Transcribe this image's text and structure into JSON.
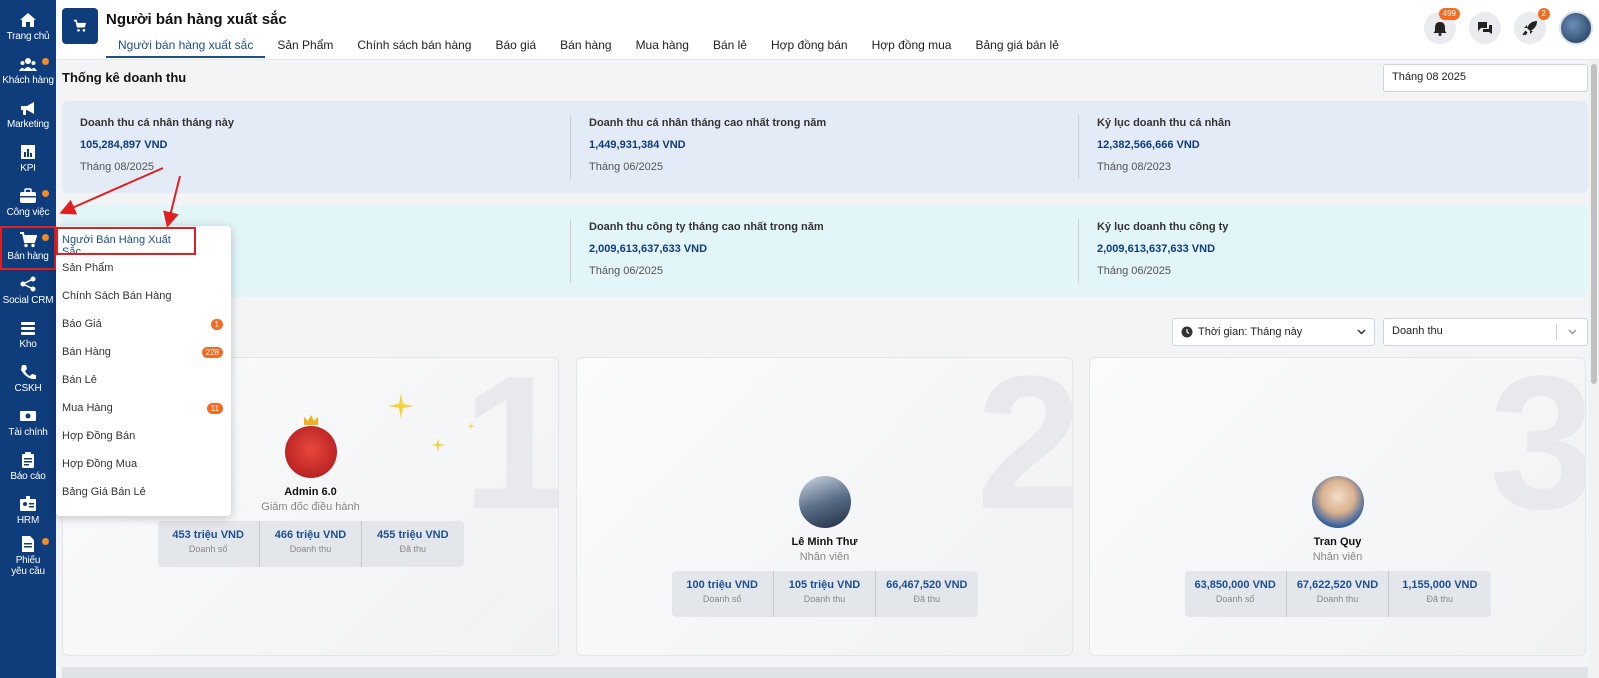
{
  "sidebar": {
    "items": [
      {
        "label": "Trang chủ",
        "icon": "home-icon"
      },
      {
        "label": "Khách hàng",
        "icon": "users-icon"
      },
      {
        "label": "Marketing",
        "icon": "megaphone-icon"
      },
      {
        "label": "KPI",
        "icon": "chart-icon"
      },
      {
        "label": "Công việc",
        "icon": "briefcase-icon"
      },
      {
        "label": "Bán hàng",
        "icon": "cart-icon"
      },
      {
        "label": "Social CRM",
        "icon": "share-icon"
      },
      {
        "label": "Kho",
        "icon": "warehouse-icon"
      },
      {
        "label": "CSKH",
        "icon": "phone-icon"
      },
      {
        "label": "Tài chính",
        "icon": "money-icon"
      },
      {
        "label": "Báo cáo",
        "icon": "clipboard-icon"
      },
      {
        "label": "HRM",
        "icon": "id-card-icon"
      },
      {
        "label": "Phiếu yêu cầu",
        "icon": "document-icon"
      }
    ]
  },
  "header": {
    "title": "Người bán hàng xuất sắc",
    "tabs": [
      "Người bán hàng xuất sắc",
      "Sản Phẩm",
      "Chính sách bán hàng",
      "Báo giá",
      "Bán hàng",
      "Mua hàng",
      "Bán lẻ",
      "Hợp đồng bán",
      "Hợp đồng mua",
      "Bảng giá bán lẻ"
    ],
    "notif_count": "499",
    "rocket_count": "2"
  },
  "main": {
    "section_title": "Thống kê doanh thu",
    "month": "Tháng 08 2025",
    "personal": [
      {
        "label": "Doanh thu cá nhân tháng này",
        "value": "105,284,897 VND",
        "date": "Tháng 08/2025"
      },
      {
        "label": "Doanh thu cá nhân tháng cao nhất trong năm",
        "value": "1,449,931,384 VND",
        "date": "Tháng 06/2025"
      },
      {
        "label": "Kỷ lục doanh thu cá nhân",
        "value": "12,382,566,666 VND",
        "date": "Tháng 08/2023"
      }
    ],
    "company": [
      {
        "label": "Doanh thu công ty tháng cao nhất trong năm",
        "value": "2,009,613,637,633 VND",
        "date": "Tháng 06/2025"
      },
      {
        "label": "Kỷ lục doanh thu công ty",
        "value": "2,009,613,637,633 VND",
        "date": "Tháng 06/2025"
      }
    ],
    "filter_time": "Thời gian: Tháng này",
    "filter_metric": "Doanh thu",
    "ranking": [
      {
        "rank": "1",
        "name": "Admin 6.0",
        "role": "Giám đốc điều hành",
        "stats": [
          {
            "v": "453 triệu VND",
            "l": "Doanh số"
          },
          {
            "v": "466 triệu VND",
            "l": "Doanh thu"
          },
          {
            "v": "455 triệu VND",
            "l": "Đã thu"
          }
        ]
      },
      {
        "rank": "2",
        "name": "Lê Minh Thư",
        "role": "Nhân viên",
        "stats": [
          {
            "v": "100 triệu VND",
            "l": "Doanh số"
          },
          {
            "v": "105 triệu VND",
            "l": "Doanh thu"
          },
          {
            "v": "66,467,520 VND",
            "l": "Đã thu"
          }
        ]
      },
      {
        "rank": "3",
        "name": "Tran Quy",
        "role": "Nhân viên",
        "stats": [
          {
            "v": "63,850,000 VND",
            "l": "Doanh số"
          },
          {
            "v": "67,622,520 VND",
            "l": "Doanh thu"
          },
          {
            "v": "1,155,000 VND",
            "l": "Đã thu"
          }
        ]
      }
    ]
  },
  "menu": {
    "items": [
      {
        "label": "Người Bán Hàng Xuất Sắc",
        "badge": ""
      },
      {
        "label": "Sản Phẩm",
        "badge": ""
      },
      {
        "label": "Chính Sách Bán Hàng",
        "badge": ""
      },
      {
        "label": "Báo Giá",
        "badge": "1"
      },
      {
        "label": "Bán Hàng",
        "badge": "228"
      },
      {
        "label": "Bán Lẻ",
        "badge": ""
      },
      {
        "label": "Mua Hàng",
        "badge": "11"
      },
      {
        "label": "Hợp Đồng Bán",
        "badge": ""
      },
      {
        "label": "Hợp Đồng Mua",
        "badge": ""
      },
      {
        "label": "Bảng Giá Bán Lẻ",
        "badge": ""
      }
    ]
  },
  "colors": {
    "sidebar": "#0f3c7a",
    "accent": "#1d4f91",
    "badge": "#f26b21",
    "highlight": "#e02020"
  }
}
